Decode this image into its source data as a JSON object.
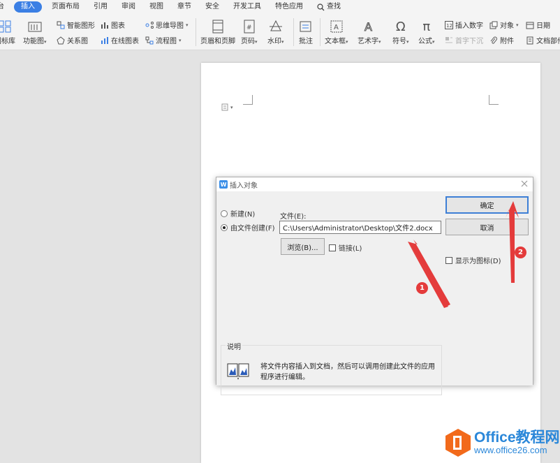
{
  "menubar": {
    "items": [
      "台",
      "插入",
      "页面布局",
      "引用",
      "审阅",
      "视图",
      "章节",
      "安全",
      "开发工具",
      "特色应用"
    ],
    "active_index": 1,
    "search_label": "查找"
  },
  "ribbon": {
    "icon_lib": "图标库",
    "function_chart": "功能图",
    "smart_graphic": "智能图形",
    "relation_chart": "关系图",
    "chart": "图表",
    "online_chart": "在线图表",
    "mind_map": "思维导图",
    "flow_chart": "流程图",
    "header_footer": "页眉和页脚",
    "page_number": "页码",
    "watermark": "水印",
    "comment": "批注",
    "textbox": "文本框",
    "art_text": "艺术字",
    "symbol": "符号",
    "formula": "公式",
    "insert_number": "插入数字",
    "drop_cap": "首字下沉",
    "object": "对象",
    "attachment": "附件",
    "date": "日期",
    "doc_part": "文档部件"
  },
  "dialog": {
    "title": "插入对象",
    "radio_new": "新建(N)",
    "radio_from_file": "由文件创建(F)",
    "file_label": "文件(E):",
    "file_path": "C:\\Users\\Administrator\\Desktop\\文件2.docx",
    "browse_label": "浏览(B)...",
    "link_label": "链接(L)",
    "ok_label": "确定",
    "cancel_label": "取消",
    "show_icon_label": "显示为图标(D)",
    "desc_title": "说明",
    "desc_text": "将文件内容插入到文档，然后可以调用创建此文件的应用程序进行编辑。"
  },
  "annotations": {
    "badge1": "1",
    "badge2": "2",
    "color": "#e43b3b"
  },
  "watermark": {
    "title": "Office教程网",
    "url": "www.office26.com"
  },
  "colors": {
    "accent": "#3b7fe4",
    "arrow": "#e43b3b",
    "brand": "#2a87d9",
    "brand_orange": "#f26a1b"
  }
}
